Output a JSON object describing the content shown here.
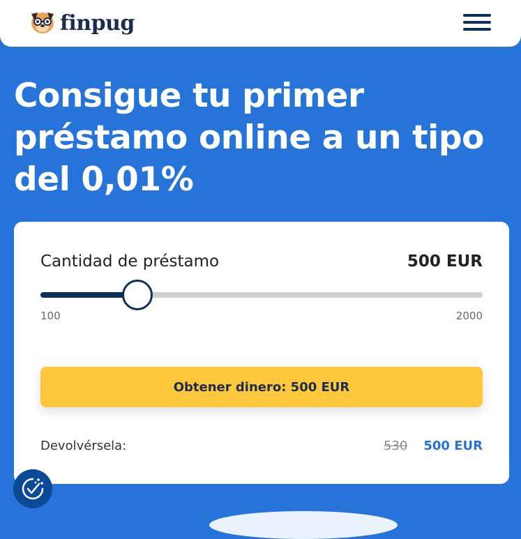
{
  "brand": {
    "name": "finpug"
  },
  "header": {
    "menu_icon": "hamburger-menu-icon"
  },
  "hero": {
    "title": "Consigue tu primer préstamo online a un tipo del 0,01%"
  },
  "calculator": {
    "amount_label": "Cantidad de préstamo",
    "amount_value": "500 EUR",
    "slider": {
      "min": 100,
      "max": 2000,
      "value": 500,
      "min_label": "100",
      "max_label": "2000"
    },
    "cta_label": "Obtener dinero: 500 EUR",
    "repay_label": "Devolvérsela:",
    "repay_old": "530",
    "repay_new": "500 EUR"
  },
  "colors": {
    "background": "#2673d9",
    "navy": "#0b2f5a",
    "cta": "#ffc73c",
    "link_blue": "#2673d9"
  },
  "icons": {
    "cookie": "cookie-consent-icon",
    "logo": "pug-logo-icon"
  }
}
